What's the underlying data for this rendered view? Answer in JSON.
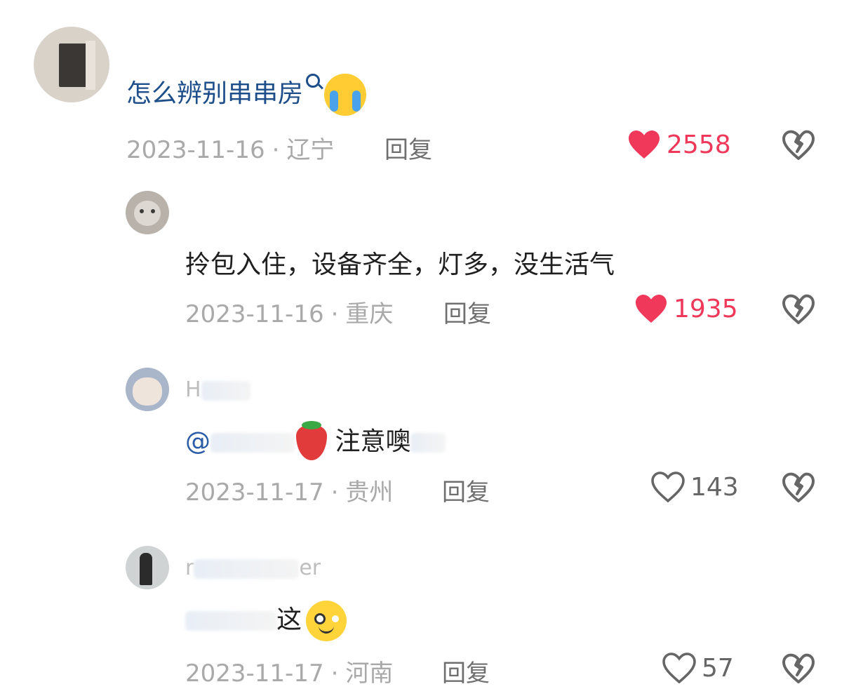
{
  "comments": [
    {
      "username": "",
      "text": "怎么辨别串串房",
      "date": "2023-11-16",
      "location": "辽宁",
      "reply_label": "回复",
      "likes": "2558",
      "liked": true
    },
    {
      "username": "",
      "text": "拎包入住，设备齐全，灯多，没生活气",
      "date": "2023-11-16",
      "location": "重庆",
      "reply_label": "回复",
      "likes": "1935",
      "liked": true
    },
    {
      "username": "H",
      "mention": "@",
      "text": "注意噢",
      "date": "2023-11-17",
      "location": "贵州",
      "reply_label": "回复",
      "likes": "143",
      "liked": false
    },
    {
      "username": "r",
      "username_suffix": "er",
      "text": "这",
      "date": "2023-11-17",
      "location": "河南",
      "reply_label": "回复",
      "likes": "57",
      "liked": false
    }
  ],
  "colors": {
    "like_active": "#f0395a",
    "link_text": "#1d4e8a",
    "meta_gray": "#a9a9a9"
  },
  "icons": [
    "search-icon",
    "crying-face-emoji",
    "heart-icon",
    "dislike-icon",
    "strawberry-emoji",
    "smiling-face-emoji"
  ]
}
